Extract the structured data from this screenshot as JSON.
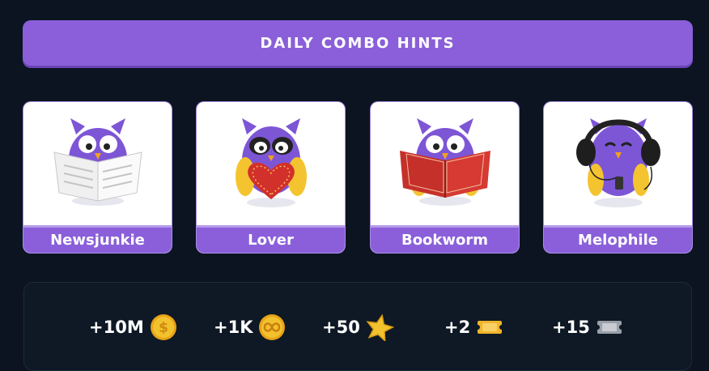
{
  "banner": {
    "title": "DAILY COMBO HINTS"
  },
  "cards": [
    {
      "label": "Newsjunkie",
      "icon": "owl-reading-newspaper-icon"
    },
    {
      "label": "Lover",
      "icon": "owl-holding-heart-icon"
    },
    {
      "label": "Bookworm",
      "icon": "owl-reading-book-icon"
    },
    {
      "label": "Melophile",
      "icon": "owl-headphones-icon"
    }
  ],
  "rewards": [
    {
      "value": "+10M",
      "icon": "dollar-coin-icon"
    },
    {
      "value": "+1K",
      "icon": "infinity-coin-icon"
    },
    {
      "value": "+50",
      "icon": "star-icon"
    },
    {
      "value": "+2",
      "icon": "gold-ticket-icon"
    },
    {
      "value": "+15",
      "icon": "silver-ticket-icon"
    }
  ],
  "colors": {
    "background": "#0b1420",
    "accent": "#8a5fd9",
    "owl_body": "#7d56d6",
    "owl_wing": "#f4c430",
    "coin": "#f2c12e"
  }
}
